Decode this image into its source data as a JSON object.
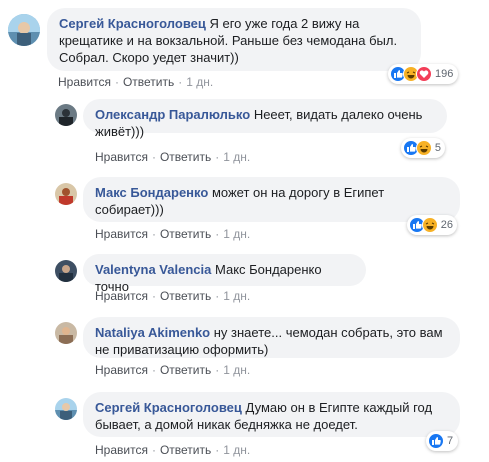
{
  "actions": {
    "like": "Нравится",
    "reply": "Ответить",
    "sep": "·"
  },
  "comments": [
    {
      "author": "Сергей Красноголовец",
      "text": "Я его уже года 2 вижу на крещатике и на вокзальной. Раньше без чемодана был. Собрал. Скоро уедет значит))",
      "time": "1 дн.",
      "reactions": {
        "icons": [
          "like-icon",
          "haha-icon",
          "love-icon"
        ],
        "count": "196"
      },
      "avatar_color": "#7fb6d8"
    },
    {
      "author": "Олександр Паралюлько",
      "text": "Нееет, видать далеко очень живёт)))",
      "time": "1 дн.",
      "reactions": {
        "icons": [
          "like-icon",
          "haha-icon"
        ],
        "count": "5"
      },
      "avatar_color": "#4a5a66"
    },
    {
      "author": "Макс Бондаренко",
      "text": "может он на дорогу в Египет собирает)))",
      "time": "1 дн.",
      "reactions": {
        "icons": [
          "like-icon",
          "haha-icon"
        ],
        "count": "26"
      },
      "avatar_color": "#b07a4a"
    },
    {
      "author": "Valentyna Valencia",
      "text": "Макс Бондаренко точно",
      "time": "1 дн."
    },
    {
      "author": "Nataliya Akimenko",
      "text": "ну знаете... чемодан собрать, это вам не приватизацию оформить)",
      "time": "1 дн."
    },
    {
      "author": "Сергей Красноголовец",
      "text": "Думаю он в Египте каждый год бывает, а домой никак бедняжка не доедет.",
      "time": "1 дн.",
      "reactions": {
        "icons": [
          "like-icon"
        ],
        "count": "7"
      }
    }
  ],
  "colors": {
    "author": "#385898",
    "bubble": "#f2f3f5",
    "like": "#1877f2",
    "haha": "#f7b125",
    "love": "#f33e58"
  }
}
